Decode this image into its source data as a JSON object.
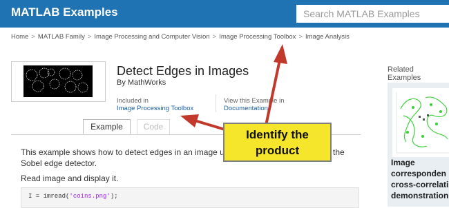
{
  "header": {
    "brand": "MATLAB Examples",
    "search_placeholder": "Search MATLAB Examples"
  },
  "breadcrumb": [
    "Home",
    "MATLAB Family",
    "Image Processing and Computer Vision",
    "Image Processing Toolbox",
    "Image Analysis"
  ],
  "breadcrumb_separator": ">",
  "example": {
    "title": "Detect Edges in Images",
    "byline": "By MathWorks",
    "included_in_label": "Included in",
    "included_in_value": "Image Processing Toolbox",
    "view_label": "View this Example in",
    "view_value": "Documentation"
  },
  "tabs": [
    {
      "label": "Example",
      "active": true
    },
    {
      "label": "Code",
      "active": false
    }
  ],
  "body": {
    "para_line1_left": "This example shows how to detect edges in an image using both",
    "para_line1_right": "the",
    "para_line2": "Sobel edge detector.",
    "read_line": "Read image and display it.",
    "code_prefix": "I = imread(",
    "code_string": "'coins.png'",
    "code_suffix": ");"
  },
  "related": {
    "title": "Related Examples",
    "card_caption": [
      "Image",
      "corresponden",
      "cross-correlati",
      "demonstration"
    ]
  },
  "annotation": {
    "callout_line1": "Identify the",
    "callout_line2": "product"
  },
  "colors": {
    "header_bg": "#1f73b3",
    "callout_bg": "#f5e62b",
    "arrow": "#c0392b",
    "link": "#1a5fa8"
  }
}
